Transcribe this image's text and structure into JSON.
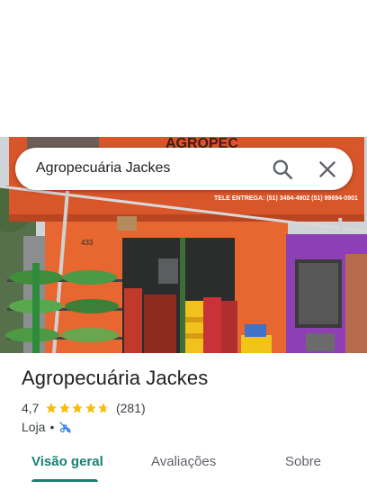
{
  "search": {
    "query": "Agropecuária Jackes"
  },
  "icons": {
    "search": "search-icon",
    "close": "close-icon",
    "no_delivery": "no-delivery-icon",
    "star": "star-icon"
  },
  "photo": {
    "sign_text": "AGROPEC",
    "phone_text": "TELE ENTREGA: (51) 3484-4902  (51) 99694-0901",
    "house_number": "433"
  },
  "place": {
    "name": "Agropecuária Jackes",
    "rating": "4,7",
    "stars": 4.7,
    "review_count": "(281)",
    "category": "Loja",
    "separator": "•"
  },
  "tabs": [
    {
      "label": "Visão geral",
      "active": true
    },
    {
      "label": "Avaliações",
      "active": false
    },
    {
      "label": "Sobre",
      "active": false
    }
  ],
  "colors": {
    "accent": "#1a7f74",
    "star": "#fbbc04",
    "facade": "#e8662f",
    "purple_wall": "#8e3fb5"
  }
}
